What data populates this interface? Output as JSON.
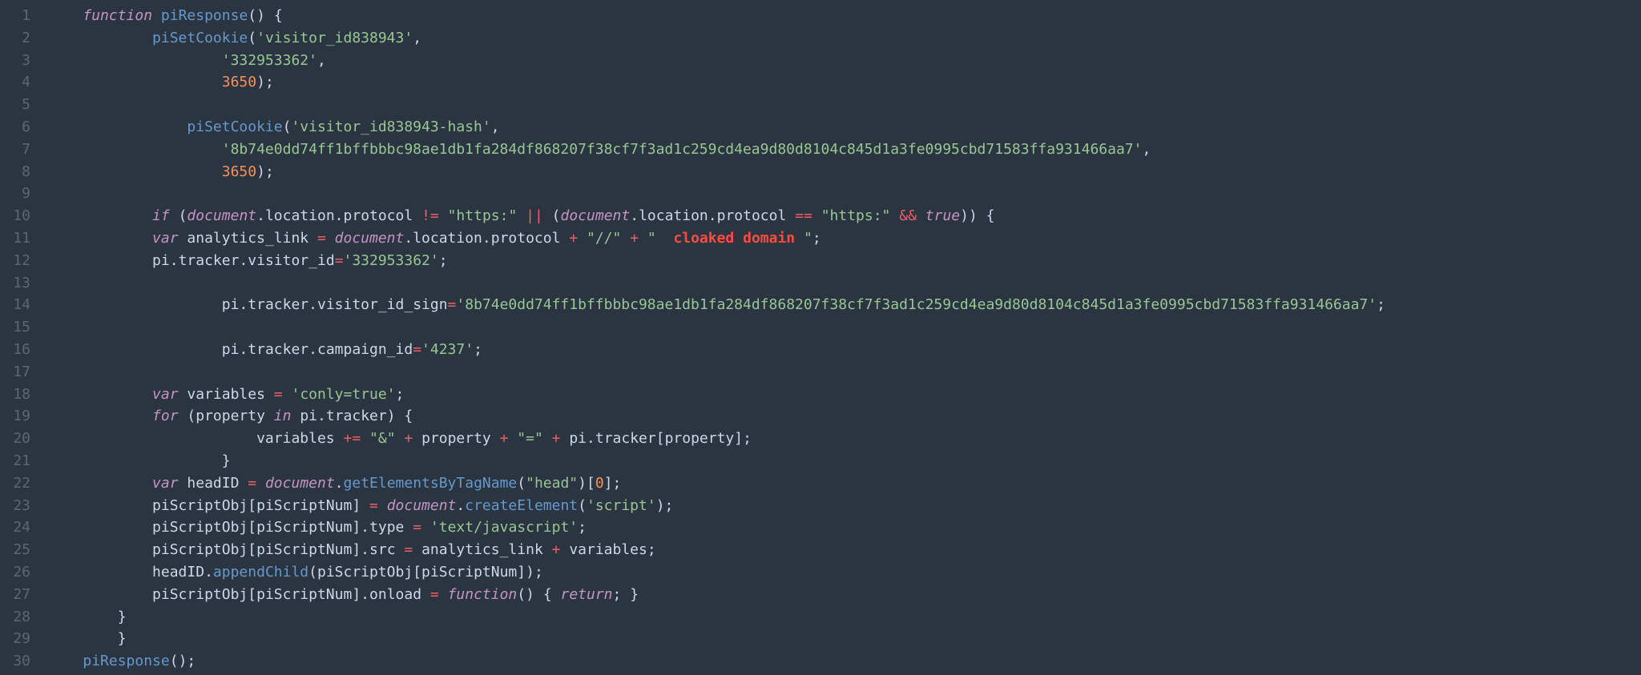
{
  "line_count": 30,
  "indent": {
    "i1": "    ",
    "i2": "        ",
    "i3": "            ",
    "i4": "                ",
    "i5": "                    ",
    "i6": "                        "
  },
  "tok": {
    "function": "function",
    "piResponse": "piResponse",
    "lp": "(",
    "rp": ")",
    "lb": "{",
    "rb": "}",
    "piSetCookie": "piSetCookie",
    "visitor_id_key": "'visitor_id838943'",
    "comma": ",",
    "visitor_id_val": "'332953362'",
    "n3650": "3650",
    "semi": ";",
    "visitor_id_hash_key": "'visitor_id838943-hash'",
    "hash_val": "'8b74e0dd74ff1bffbbbc98ae1db1fa284df868207f38cf7f3ad1c259cd4ea9d80d8104c845d1a3fe0995cbd71583ffa931466aa7'",
    "if": "if",
    "document": "document",
    "dot": ".",
    "location": "location",
    "protocol": "protocol",
    "neq": "!=",
    "https": "\"https:\"",
    "or": "||",
    "eqeq": "==",
    "and": "&&",
    "true": "true",
    "var": "var",
    "analytics_link": "analytics_link",
    "eq": "=",
    "plus": "+",
    "dblslash": "\"//\"",
    "space_q": "\" ",
    "cloaked": "cloaked domain",
    "close_q": "\"",
    "pi": "pi",
    "tracker": "tracker",
    "visitor_id_prop": "visitor_id",
    "visitor_id_sign_prop": "visitor_id_sign",
    "campaign_id_prop": "campaign_id",
    "campaign_val": "'4237'",
    "variables": "variables",
    "conly": "'conly=true'",
    "for": "for",
    "property": "property",
    "in": "in",
    "pluseq": "+=",
    "amp": "\"&\"",
    "eqlit": "\"=\"",
    "lbr": "[",
    "rbr": "]",
    "headID": "headID",
    "getElementsByTagName": "getElementsByTagName",
    "head_str": "\"head\"",
    "zero": "0",
    "piScriptObj": "piScriptObj",
    "piScriptNum": "piScriptNum",
    "createElement": "createElement",
    "script_str": "'script'",
    "type": "type",
    "textjs": "'text/javascript'",
    "src": "src",
    "appendChild": "appendChild",
    "onload": "onload",
    "return": "return",
    "piResponseCall": "piResponse"
  }
}
